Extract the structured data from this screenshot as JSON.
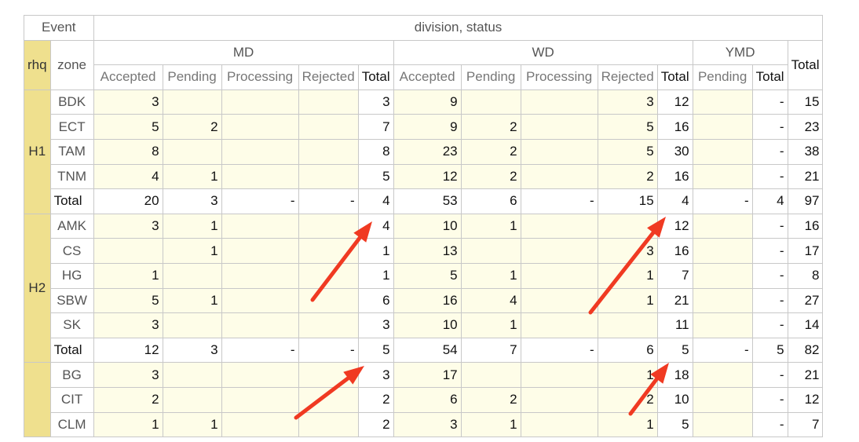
{
  "header": {
    "event": "Event",
    "division_status": "division, status",
    "rhq": "rhq",
    "zone": "zone",
    "total": "Total",
    "divisions": [
      {
        "name": "MD",
        "statuses": [
          "Accepted",
          "Pending",
          "Processing",
          "Rejected",
          "Total"
        ]
      },
      {
        "name": "WD",
        "statuses": [
          "Accepted",
          "Pending",
          "Processing",
          "Rejected",
          "Total"
        ]
      },
      {
        "name": "YMD",
        "statuses": [
          "Pending",
          "Total"
        ]
      }
    ]
  },
  "groups": [
    {
      "rhq": "H1",
      "rows": [
        {
          "zone": "BDK",
          "cells": [
            "3",
            "",
            "",
            "",
            "3",
            "9",
            "",
            "",
            "3",
            "12",
            "",
            "-",
            "15"
          ]
        },
        {
          "zone": "ECT",
          "cells": [
            "5",
            "2",
            "",
            "",
            "7",
            "9",
            "2",
            "",
            "5",
            "16",
            "",
            "-",
            "23"
          ]
        },
        {
          "zone": "TAM",
          "cells": [
            "8",
            "",
            "",
            "",
            "8",
            "23",
            "2",
            "",
            "5",
            "30",
            "",
            "-",
            "38"
          ]
        },
        {
          "zone": "TNM",
          "cells": [
            "4",
            "1",
            "",
            "",
            "5",
            "12",
            "2",
            "",
            "2",
            "16",
            "",
            "-",
            "21"
          ]
        },
        {
          "zone": "Total",
          "total": true,
          "cells": [
            "20",
            "3",
            "-",
            "-",
            "4",
            "53",
            "6",
            "-",
            "15",
            "4",
            "-",
            "4",
            "97"
          ]
        }
      ]
    },
    {
      "rhq": "H2",
      "rows": [
        {
          "zone": "AMK",
          "cells": [
            "3",
            "1",
            "",
            "",
            "4",
            "10",
            "1",
            "",
            "",
            "12",
            "",
            "-",
            "16"
          ]
        },
        {
          "zone": "CS",
          "cells": [
            "",
            "1",
            "",
            "",
            "1",
            "13",
            "",
            "",
            "3",
            "16",
            "",
            "-",
            "17"
          ]
        },
        {
          "zone": "HG",
          "cells": [
            "1",
            "",
            "",
            "",
            "1",
            "5",
            "1",
            "",
            "1",
            "7",
            "",
            "-",
            "8"
          ]
        },
        {
          "zone": "SBW",
          "cells": [
            "5",
            "1",
            "",
            "",
            "6",
            "16",
            "4",
            "",
            "1",
            "21",
            "",
            "-",
            "27"
          ]
        },
        {
          "zone": "SK",
          "cells": [
            "3",
            "",
            "",
            "",
            "3",
            "10",
            "1",
            "",
            "",
            "11",
            "",
            "-",
            "14"
          ]
        },
        {
          "zone": "Total",
          "total": true,
          "cells": [
            "12",
            "3",
            "-",
            "-",
            "5",
            "54",
            "7",
            "-",
            "6",
            "5",
            "-",
            "5",
            "82"
          ]
        }
      ]
    },
    {
      "rhq": "",
      "rows": [
        {
          "zone": "BG",
          "cells": [
            "3",
            "",
            "",
            "",
            "3",
            "17",
            "",
            "",
            "1",
            "18",
            "",
            "-",
            "21"
          ]
        },
        {
          "zone": "CIT",
          "cells": [
            "2",
            "",
            "",
            "",
            "2",
            "6",
            "2",
            "",
            "2",
            "10",
            "",
            "-",
            "12"
          ]
        },
        {
          "zone": "CLM",
          "cells": [
            "1",
            "1",
            "",
            "",
            "2",
            "3",
            "1",
            "",
            "1",
            "5",
            "",
            "-",
            "7"
          ]
        }
      ]
    }
  ],
  "annotation": {
    "arrow_color": "#f03a22"
  }
}
